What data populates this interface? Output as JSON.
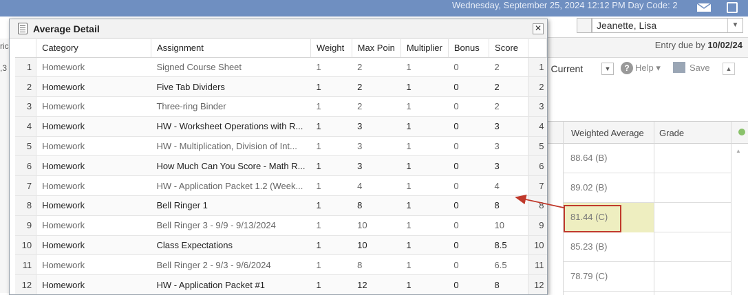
{
  "header": {
    "datetime": "Wednesday, September 25, 2024   12:12 PM   Day Code: 2"
  },
  "background": {
    "student": "Jeanette, Lisa",
    "entry_due_label": "Entry due by",
    "entry_due_date": "10/02/24",
    "current_label": ") Current",
    "help_label": "Help ▾",
    "save_label": "Save",
    "left_strip_top": "ric",
    "left_strip_mid": ",3",
    "columns": {
      "weighted_average": "Weighted Average",
      "grade": "Grade"
    },
    "rows": [
      {
        "weighted_average": "88.64 (B)"
      },
      {
        "weighted_average": "89.02 (B)"
      },
      {
        "weighted_average": "81.44 (C)"
      },
      {
        "weighted_average": "85.23 (B)"
      },
      {
        "weighted_average": "78.79 (C)"
      }
    ],
    "highlighted_row_index": 2
  },
  "modal": {
    "title": "Average Detail",
    "close_symbol": "✕",
    "columns": {
      "category": "Category",
      "assignment": "Assignment",
      "weight": "Weight",
      "max_points": "Max Poin",
      "multiplier": "Multiplier",
      "bonus": "Bonus",
      "score": "Score"
    },
    "rows": [
      {
        "n": "1",
        "category": "Homework",
        "assignment": "Signed Course Sheet",
        "weight": "1",
        "max": "2",
        "mult": "1",
        "bonus": "0",
        "score": "2"
      },
      {
        "n": "2",
        "category": "Homework",
        "assignment": "Five Tab Dividers",
        "weight": "1",
        "max": "2",
        "mult": "1",
        "bonus": "0",
        "score": "2"
      },
      {
        "n": "3",
        "category": "Homework",
        "assignment": "Three-ring Binder",
        "weight": "1",
        "max": "2",
        "mult": "1",
        "bonus": "0",
        "score": "2"
      },
      {
        "n": "4",
        "category": "Homework",
        "assignment": "HW - Worksheet Operations with R...",
        "weight": "1",
        "max": "3",
        "mult": "1",
        "bonus": "0",
        "score": "3"
      },
      {
        "n": "5",
        "category": "Homework",
        "assignment": "HW - Multiplication, Division of Int...",
        "weight": "1",
        "max": "3",
        "mult": "1",
        "bonus": "0",
        "score": "3"
      },
      {
        "n": "6",
        "category": "Homework",
        "assignment": "How Much Can You Score - Math R...",
        "weight": "1",
        "max": "3",
        "mult": "1",
        "bonus": "0",
        "score": "3"
      },
      {
        "n": "7",
        "category": "Homework",
        "assignment": "HW - Application Packet 1.2 (Week...",
        "weight": "1",
        "max": "4",
        "mult": "1",
        "bonus": "0",
        "score": "4"
      },
      {
        "n": "8",
        "category": "Homework",
        "assignment": "Bell Ringer 1",
        "weight": "1",
        "max": "8",
        "mult": "1",
        "bonus": "0",
        "score": "8"
      },
      {
        "n": "9",
        "category": "Homework",
        "assignment": "Bell Ringer 3 - 9/9 - 9/13/2024",
        "weight": "1",
        "max": "10",
        "mult": "1",
        "bonus": "0",
        "score": "10"
      },
      {
        "n": "10",
        "category": "Homework",
        "assignment": "Class Expectations",
        "weight": "1",
        "max": "10",
        "mult": "1",
        "bonus": "0",
        "score": "8.5"
      },
      {
        "n": "11",
        "category": "Homework",
        "assignment": "Bell Ringer 2 - 9/3 - 9/6/2024",
        "weight": "1",
        "max": "8",
        "mult": "1",
        "bonus": "0",
        "score": "6.5"
      },
      {
        "n": "12",
        "category": "Homework",
        "assignment": "HW - Application Packet #1",
        "weight": "1",
        "max": "12",
        "mult": "1",
        "bonus": "0",
        "score": "8"
      }
    ]
  },
  "colors": {
    "topbar": "#6f8fc1",
    "highlight_fill": "#eeeec0",
    "highlight_border": "#c0392b",
    "arrow": "#c0392b"
  }
}
